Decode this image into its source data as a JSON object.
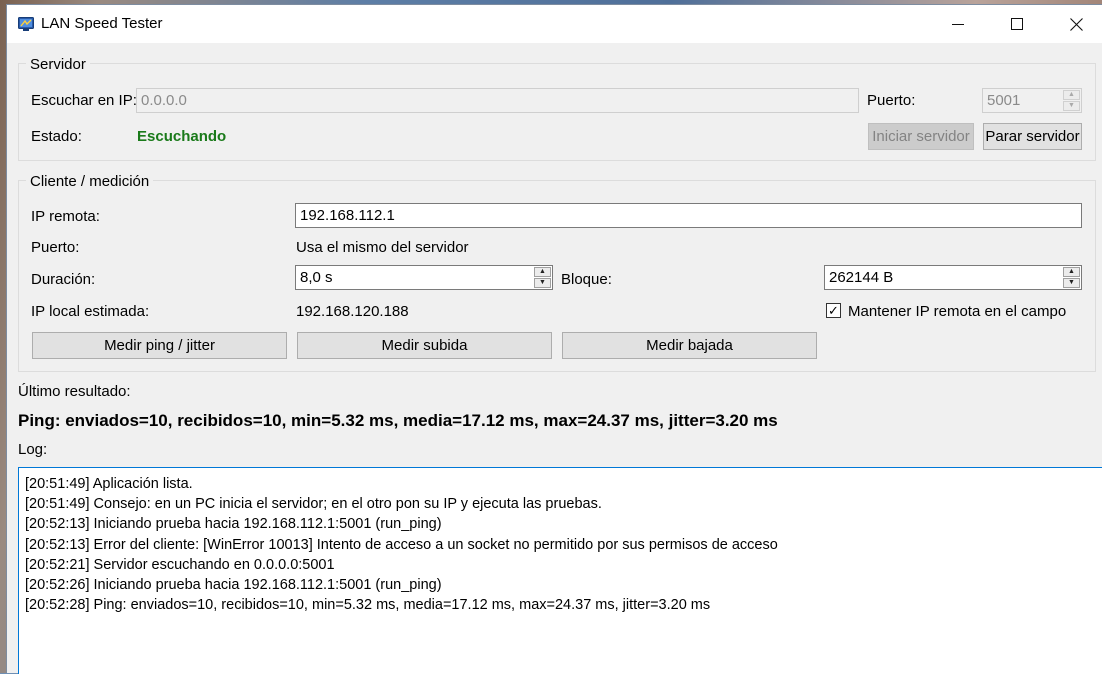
{
  "window": {
    "title": "LAN Speed Tester"
  },
  "server": {
    "group_title": "Servidor",
    "listen_label": "Escuchar en IP:",
    "listen_value": "0.0.0.0",
    "port_label": "Puerto:",
    "port_value": "5001",
    "status_label": "Estado:",
    "status_value": "Escuchando",
    "status_color": "#1a7a1a",
    "start_button": "Iniciar servidor",
    "stop_button": "Parar servidor"
  },
  "client": {
    "group_title": "Cliente / medición",
    "remote_ip_label": "IP remota:",
    "remote_ip_value": "192.168.112.1",
    "port_label": "Puerto:",
    "port_value": "Usa el mismo del servidor",
    "duration_label": "Duración:",
    "duration_value": "8,0 s",
    "block_label": "Bloque:",
    "block_value": "262144 B",
    "local_ip_label": "IP local estimada:",
    "local_ip_value": "192.168.120.188",
    "keep_ip_label": "Mantener IP remota en el campo",
    "keep_ip_checked": true,
    "ping_button": "Medir ping / jitter",
    "upload_button": "Medir subida",
    "download_button": "Medir bajada"
  },
  "result": {
    "label": "Último resultado:",
    "value": "Ping: enviados=10, recibidos=10, min=5.32 ms, media=17.12 ms, max=24.37 ms, jitter=3.20 ms"
  },
  "log": {
    "label": "Log:",
    "lines": [
      "[20:51:49] Aplicación lista.",
      "[20:51:49] Consejo: en un PC inicia el servidor; en el otro pon su IP y ejecuta las pruebas.",
      "[20:52:13] Iniciando prueba hacia 192.168.112.1:5001 (run_ping)",
      "[20:52:13] Error del cliente: [WinError 10013] Intento de acceso a un socket no permitido por sus permisos de acceso",
      "[20:52:21] Servidor escuchando en 0.0.0.0:5001",
      "[20:52:26] Iniciando prueba hacia 192.168.112.1:5001 (run_ping)",
      "[20:52:28] Ping: enviados=10, recibidos=10, min=5.32 ms, media=17.12 ms, max=24.37 ms, jitter=3.20 ms"
    ]
  },
  "icons": {
    "app": "lan-tester-icon",
    "minimize": "minimize-icon",
    "maximize": "maximize-icon",
    "close": "close-icon"
  }
}
